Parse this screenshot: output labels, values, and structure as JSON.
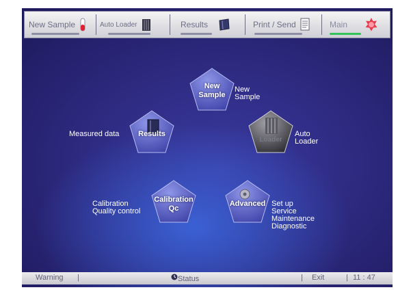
{
  "toolbar": {
    "new_sample": "New Sample",
    "auto_loader": "Auto Loader",
    "results": "Results",
    "print_send": "Print / Send",
    "main": "Main"
  },
  "buttons": {
    "new_sample": {
      "label_line1": "New",
      "label_line2": "Sample",
      "side_line1": "New",
      "side_line2": "Sample"
    },
    "results": {
      "label": "Results",
      "side": "Measured data"
    },
    "loader": {
      "label": "Loader",
      "side_line1": "Auto",
      "side_line2": "Loader"
    },
    "calibration": {
      "label_line1": "Calibration",
      "label_line2": "Qc",
      "side_line1": "Calibration",
      "side_line2": "Quality control"
    },
    "advanced": {
      "label": "Advanced",
      "side_lines": [
        "Set up",
        "Service",
        "Maintenance",
        "Diagnostic"
      ]
    }
  },
  "statusbar": {
    "warning": "Warning",
    "status": "Status",
    "exit": "Exit",
    "time": "11 : 47"
  },
  "colors": {
    "background": "#2a2678",
    "accent_green": "#34c25a",
    "main_icon_red": "#e83a4a"
  }
}
